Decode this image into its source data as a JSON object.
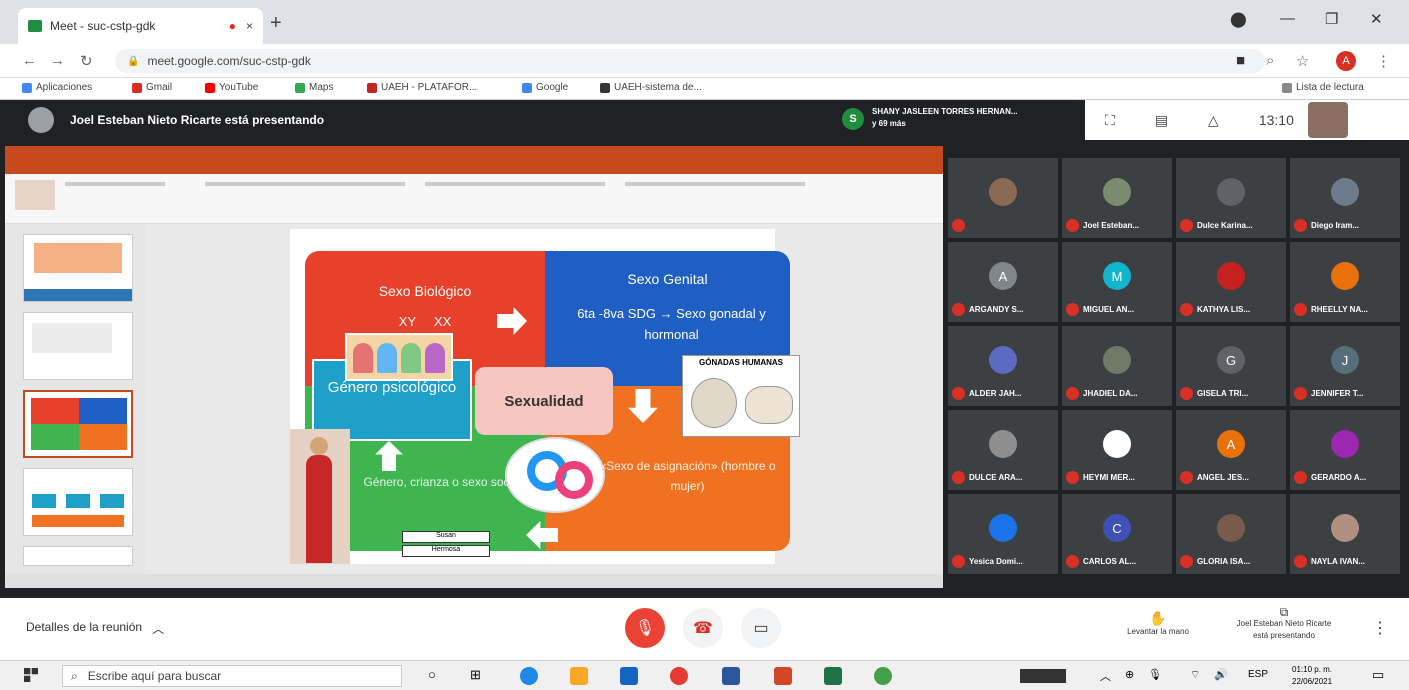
{
  "browser": {
    "tab_title": "Meet - suc-cstp-gdk",
    "tab_close": "×",
    "new_tab": "+",
    "url": "meet.google.com/suc-cstp-gdk",
    "bookmarks": [
      {
        "label": "Aplicaciones",
        "color": "#4285f4"
      },
      {
        "label": "Gmail",
        "color": "#d93025"
      },
      {
        "label": "YouTube",
        "color": "#ff0000"
      },
      {
        "label": "Maps",
        "color": "#34a853"
      },
      {
        "label": "UAEH - PLATAFOR...",
        "color": "#c5221f"
      },
      {
        "label": "Google",
        "color": "#4285f4"
      },
      {
        "label": "UAEH-sistema de...",
        "color": "#333333"
      }
    ],
    "reading_list": "Lista de lectura",
    "profile_initial": "A"
  },
  "meet": {
    "presenter_text": "Joel Esteban Nieto Ricarte está presentando",
    "participants_summary_line1": "SHANY JASLEEN TORRES HERNAN...",
    "participants_summary_line2": "y 69 más",
    "participant_initial": "S",
    "time": "13:10",
    "meeting_details": "Detalles de la reunión",
    "raise_hand": "Levantar la mano",
    "presenting_line1": "Joel Esteban Nieto Ricarte",
    "presenting_line2": "está presentando",
    "participants": [
      {
        "name": "",
        "initial": "",
        "color": "#8a6a55"
      },
      {
        "name": "Joel Esteban...",
        "initial": "",
        "color": "#7b8b6f"
      },
      {
        "name": "Dulce Karina...",
        "initial": "",
        "color": "#5f6368"
      },
      {
        "name": "Diego Iram...",
        "initial": "",
        "color": "#6d7c8a"
      },
      {
        "name": "ARGANDY S...",
        "initial": "A",
        "color": "#80868b"
      },
      {
        "name": "MIGUEL AN...",
        "initial": "M",
        "color": "#12b5cb"
      },
      {
        "name": "KATHYA LIS...",
        "initial": "",
        "color": "#c5221f"
      },
      {
        "name": "RHEELLY NA...",
        "initial": "",
        "color": "#e8710a"
      },
      {
        "name": "ALDER JAH...",
        "initial": "",
        "color": "#5c6bc0"
      },
      {
        "name": "JHADIEL DA...",
        "initial": "",
        "color": "#6f7b66"
      },
      {
        "name": "GISELA TRI...",
        "initial": "G",
        "color": "#5f6368"
      },
      {
        "name": "JENNIFER T...",
        "initial": "J",
        "color": "#546e7a"
      },
      {
        "name": "DULCE ARA...",
        "initial": "",
        "color": "#8e8e8e"
      },
      {
        "name": "HEYMI MER...",
        "initial": "",
        "color": "#ffffff"
      },
      {
        "name": "ANGEL JES...",
        "initial": "A",
        "color": "#e8710a"
      },
      {
        "name": "GERARDO A...",
        "initial": "",
        "color": "#9c27b0"
      },
      {
        "name": "Yesica Domi...",
        "initial": "",
        "color": "#1a73e8"
      },
      {
        "name": "CARLOS AL...",
        "initial": "C",
        "color": "#3f51b5"
      },
      {
        "name": "GLORIA ISA...",
        "initial": "",
        "color": "#7a5a4a"
      },
      {
        "name": "NAYLA IVAN...",
        "initial": "",
        "color": "#b09080"
      }
    ]
  },
  "slide": {
    "sexo_biologico": "Sexo Biológico",
    "xy_xx": "XY     XX",
    "sexo_genital": "Sexo Genital",
    "genital_desc": "6ta -8va SDG → Sexo gonadal y hormonal",
    "genero_psicologico": "Género psicológico",
    "sexualidad": "Sexualidad",
    "gonadas": "GÓNADAS HUMANAS",
    "genero_crianza": "Género, crianza o sexo social",
    "sexo_asignacion": "«Sexo de asignación» (hombre o mujer)",
    "label1": "Susan",
    "label2": "Hermosa"
  },
  "taskbar": {
    "search_placeholder": "Escribe aquí para buscar",
    "lang": "ESP",
    "clock_time": "01:10 p. m.",
    "clock_date": "22/06/2021"
  }
}
